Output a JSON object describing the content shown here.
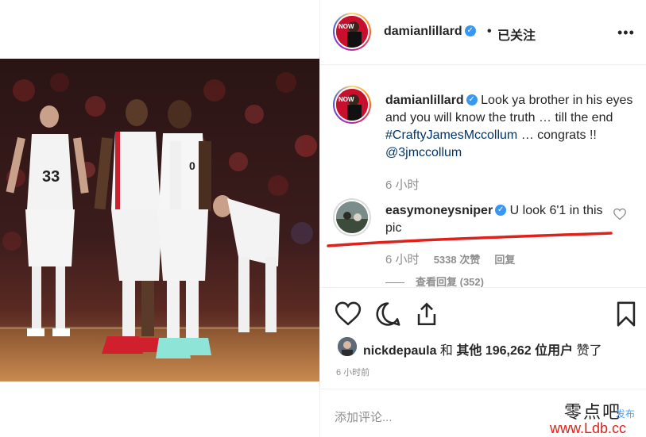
{
  "header": {
    "username": "damianlillard",
    "separator": "•",
    "follow_status": "已关注",
    "more_icon": "ellipsis-icon"
  },
  "caption": {
    "username": "damianlillard",
    "text_1": "Look ya brother in his eyes and you will know the truth … till the end ",
    "hashtag": "#CraftyJamesMccollum",
    "text_2": " … congrats !! ",
    "mention": "@3jmccollum",
    "time": "6 小时"
  },
  "comment": {
    "username": "easymoneysniper",
    "text": "U look 6'1 in this pic",
    "time": "6 小时",
    "likes": "5338 次赞",
    "reply": "回复",
    "view_replies": "查看回复 (352)"
  },
  "likes_row": {
    "user": "nickdepaula",
    "and": " 和 ",
    "others": "其他 196,262 位用户",
    "suffix": " 赞了"
  },
  "post_time": "6 小时前",
  "comment_input": {
    "placeholder": "添加评论..."
  },
  "watermark": {
    "brand": "零点吧",
    "site": "www.Ldb.cc",
    "tag": "发布"
  },
  "colors": {
    "verified": "#3897f0",
    "link": "#003569",
    "muted": "#8e8e8e",
    "underline": "#e0201a"
  }
}
